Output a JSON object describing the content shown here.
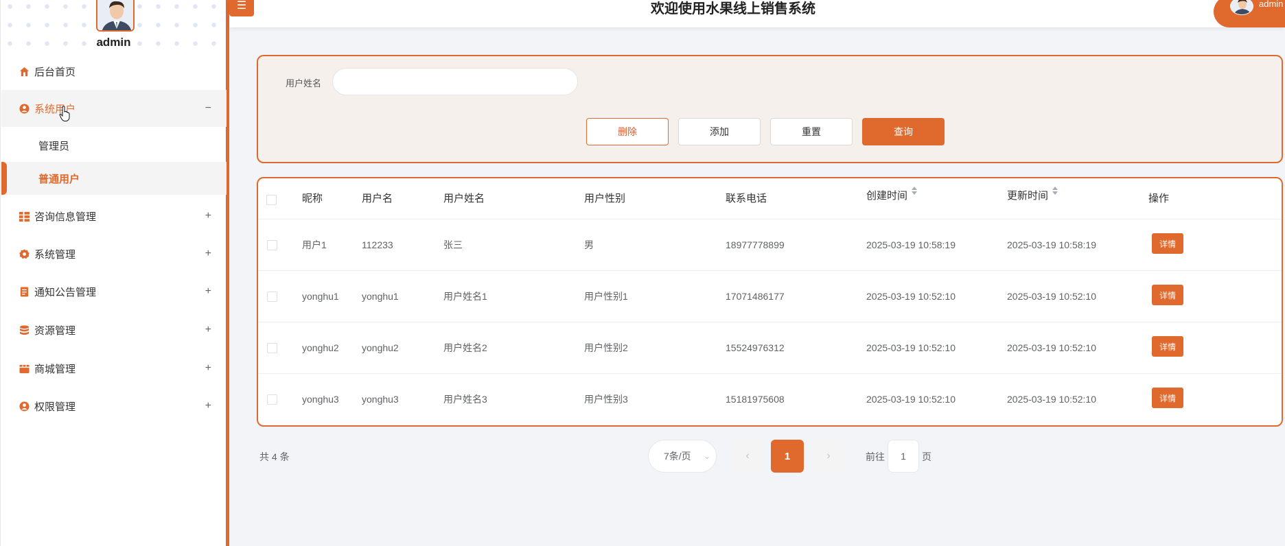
{
  "sidebar": {
    "username": "admin",
    "items": [
      {
        "label": "后台首页",
        "icon": "home-icon"
      },
      {
        "label": "系统用户",
        "icon": "user-circle-icon",
        "toggle": "−"
      },
      {
        "label": "咨询信息管理",
        "icon": "grid-icon",
        "toggle": "+"
      },
      {
        "label": "系统管理",
        "icon": "gear-icon",
        "toggle": "+"
      },
      {
        "label": "通知公告管理",
        "icon": "document-icon",
        "toggle": "+"
      },
      {
        "label": "资源管理",
        "icon": "database-icon",
        "toggle": "+"
      },
      {
        "label": "商城管理",
        "icon": "shop-icon",
        "toggle": "+"
      },
      {
        "label": "权限管理",
        "icon": "person-icon",
        "toggle": "+"
      }
    ],
    "sub_items": [
      {
        "label": "管理员"
      },
      {
        "label": "普通用户"
      }
    ]
  },
  "header": {
    "title": "欢迎使用水果线上销售系统",
    "username": "admin",
    "menu_icon": "☰"
  },
  "search": {
    "label": "用户姓名",
    "value": "",
    "placeholder": "",
    "buttons": {
      "delete": "删除",
      "add": "添加",
      "reset": "重置",
      "query": "查询"
    }
  },
  "table": {
    "columns": [
      "昵称",
      "用户名",
      "用户姓名",
      "用户性别",
      "联系电话",
      "创建时间",
      "更新时间",
      "操作"
    ],
    "rows": [
      {
        "nickname": "用户1",
        "username": "112233",
        "name": "张三",
        "gender": "男",
        "phone": "18977778899",
        "created": "2025-03-19 10:58:19",
        "updated": "2025-03-19 10:58:19",
        "action": "详情"
      },
      {
        "nickname": "yonghu1",
        "username": "yonghu1",
        "name": "用户姓名1",
        "gender": "用户性别1",
        "phone": "17071486177",
        "created": "2025-03-19 10:52:10",
        "updated": "2025-03-19 10:52:10",
        "action": "详情"
      },
      {
        "nickname": "yonghu2",
        "username": "yonghu2",
        "name": "用户姓名2",
        "gender": "用户性别2",
        "phone": "15524976312",
        "created": "2025-03-19 10:52:10",
        "updated": "2025-03-19 10:52:10",
        "action": "详情"
      },
      {
        "nickname": "yonghu3",
        "username": "yonghu3",
        "name": "用户姓名3",
        "gender": "用户性别3",
        "phone": "15181975608",
        "created": "2025-03-19 10:52:10",
        "updated": "2025-03-19 10:52:10",
        "action": "详情"
      }
    ]
  },
  "pagination": {
    "total": "共 4 条",
    "page_size": "7条/页",
    "current_page": "1",
    "goto_label": "前往",
    "goto_value": "1",
    "goto_suffix": "页"
  },
  "colors": {
    "accent": "#e0692e",
    "panel_bg": "#f6f0ec",
    "page_bg": "#f3f4f8"
  }
}
